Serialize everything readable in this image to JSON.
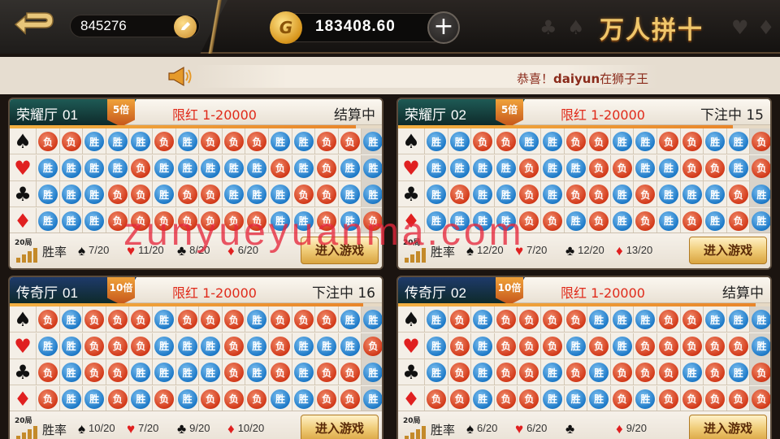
{
  "header": {
    "user_id": "845276",
    "coins": "183408.60",
    "title": "万人拼十",
    "add_label": "+"
  },
  "notice": {
    "prefix": "恭喜！",
    "name": "daiyun",
    "text": "在狮子王"
  },
  "watermark": "zunyueyuanma.com",
  "common": {
    "win_label": "胜",
    "lose_label": "负",
    "winrate_label": "胜率",
    "rounds_label": "20局",
    "enter_label": "进入游戏",
    "limit": "限红 1-20000"
  },
  "colors": {
    "glory_header": "#1e5a55",
    "legend_header": "#1e3a6a",
    "win": "#1e7ac8",
    "lose": "#d33a1a",
    "accent_gold": "#f0c66a"
  },
  "rooms": [
    {
      "name": "荣耀厅",
      "num": "01",
      "mult": "5倍",
      "status": "结算中",
      "progress": 0.93,
      "rows": [
        "LLWWWLWLLLWWLLW",
        "WWWWLWWWWWLWLWW",
        "WWWLLWLLWWWLLWW",
        "WWWLLLLLLLWWLWL"
      ],
      "stats": {
        "spade": "7/20",
        "heart": "11/20",
        "club": "8/20",
        "diamond": "6/20"
      }
    },
    {
      "name": "荣耀厅",
      "num": "02",
      "mult": "5倍",
      "status": "下注中 15",
      "progress": 0.9,
      "rows": [
        "WWLLWWLLWWLLWWL",
        "WWWWLWWLLWWLLWL",
        "WLWWLWLLWLWWWLW",
        "WWWWLLWLWLWLWLW"
      ],
      "stats": {
        "spade": "12/20",
        "heart": "7/20",
        "club": "12/20",
        "diamond": "13/20"
      }
    },
    {
      "name": "传奇厅",
      "num": "01",
      "mult": "10倍",
      "status": "下注中 16",
      "progress": 0.95,
      "rows": [
        "LWLLLWLLLWLLLWW",
        "WWLLLWWWLWLWWWL",
        "LWLLWWWWLWLWLLW",
        "LWWLWLWLLLWWLLW"
      ],
      "stats": {
        "spade": "10/20",
        "heart": "7/20",
        "club": "9/20",
        "diamond": "10/20"
      }
    },
    {
      "name": "传奇厅",
      "num": "02",
      "mult": "10倍",
      "status": "结算中",
      "progress": 0.96,
      "rows": [
        "WLWLLLLWWWLLWWW",
        "WLWLLLWLWLLLLLW",
        "WLWLLWLWLLLWLWL",
        "LLWLLWWWLWLLLLL"
      ],
      "stats": {
        "spade": "6/20",
        "heart": "6/20",
        "club": "",
        "diamond": "9/20"
      }
    }
  ]
}
